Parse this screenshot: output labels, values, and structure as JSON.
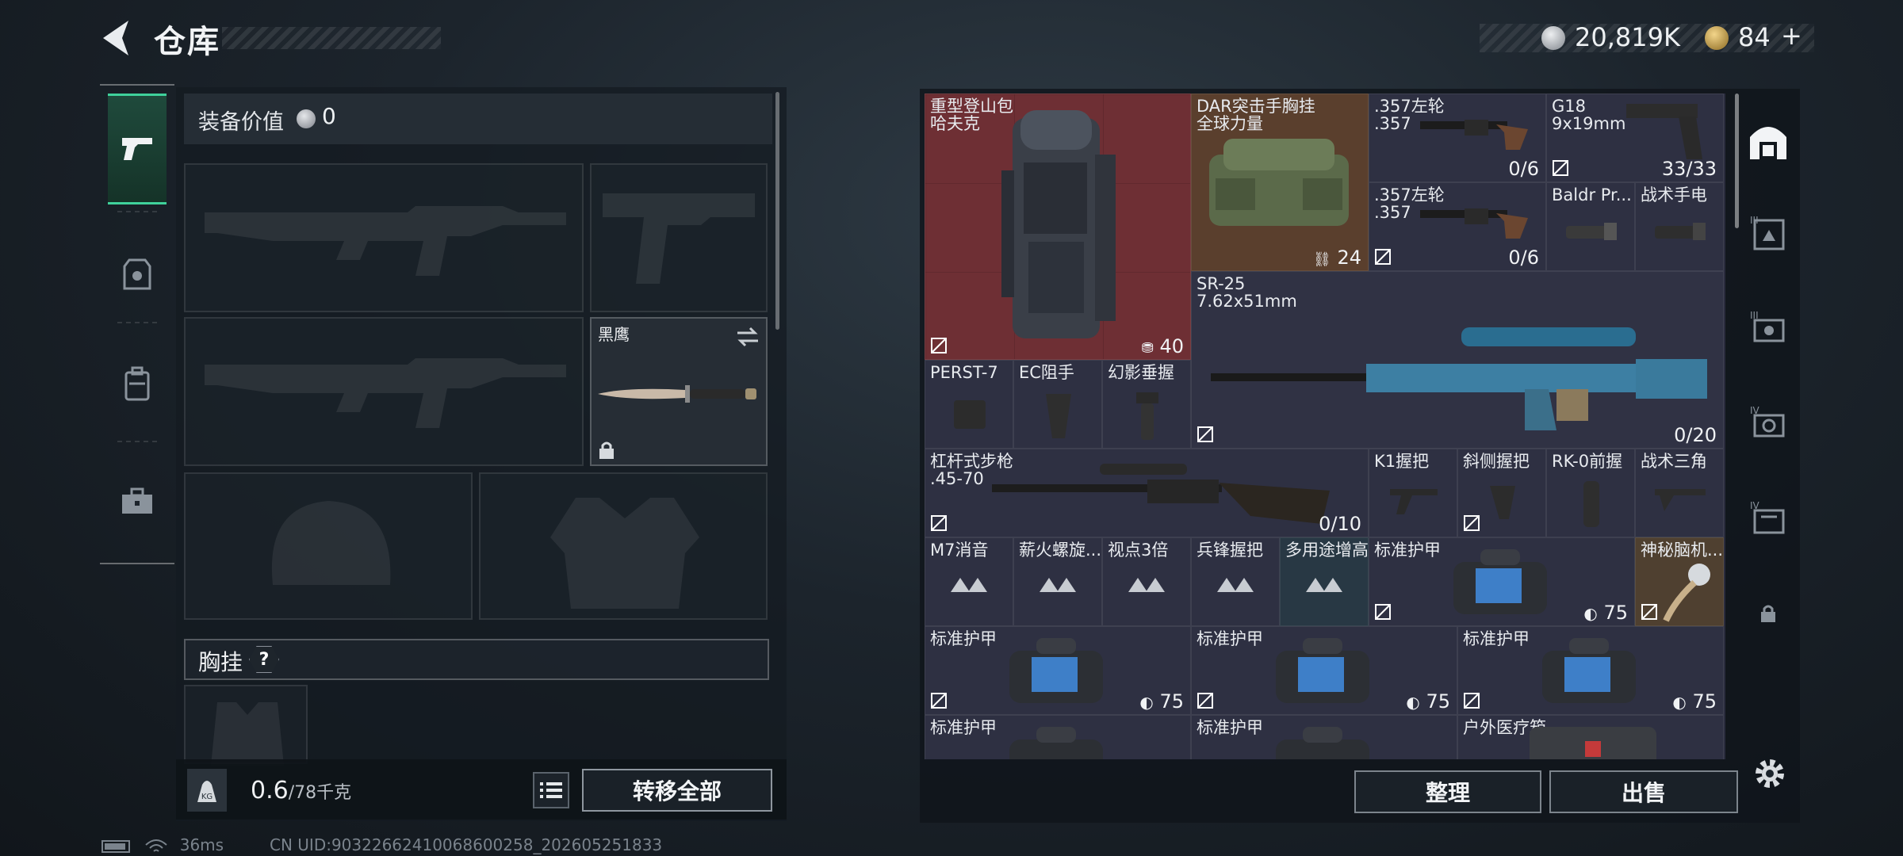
{
  "header": {
    "title": "仓库",
    "silver_amount": "20,819K",
    "gold_amount": "84",
    "gold_plus": "+"
  },
  "colors": {
    "accent_green": "#3fd19b",
    "backpack_bg": "#6e2f34",
    "rig_bg": "#5a3f2d",
    "knife_slot": "#2a3038",
    "grid_bg": "#2e3042"
  },
  "categories": [
    {
      "icon": "pistol-icon",
      "active": true
    },
    {
      "icon": "armor-icon",
      "active": false
    },
    {
      "icon": "backpack-icon",
      "active": false
    },
    {
      "icon": "toolbox-icon",
      "active": false
    }
  ],
  "equipment": {
    "value_label": "装备价值",
    "value": "0",
    "knife_name": "黑鹰",
    "chest_label": "胸挂",
    "chest_help": "?",
    "weight": "0.6",
    "weight_max": "/78千克",
    "transfer_all": "转移全部"
  },
  "status": {
    "ping": "36ms",
    "uid": "CN UID:90322662410068600258_202605251833"
  },
  "stash": {
    "items": [
      {
        "id": "backpack",
        "name1": "重型登山包",
        "name2": "哈夫克",
        "count": "40"
      },
      {
        "id": "rig",
        "name1": "DAR突击手胸挂",
        "name2": "全球力量",
        "count": "24"
      },
      {
        "id": "revolver1",
        "name1": ".357左轮",
        "name2": ".357",
        "count": "0/6"
      },
      {
        "id": "g18",
        "name1": "G18",
        "name2": "9x19mm",
        "count": "33/33"
      },
      {
        "id": "revolver2",
        "name1": ".357左轮",
        "name2": ".357",
        "count": "0/6"
      },
      {
        "id": "baldr",
        "name1": "Baldr Pr..."
      },
      {
        "id": "flashlight",
        "name1": "战术手电"
      },
      {
        "id": "sr25",
        "name1": "SR-25",
        "name2": "7.62x51mm",
        "count": "0/20"
      },
      {
        "id": "perst",
        "name1": "PERST-7"
      },
      {
        "id": "ec",
        "name1": "EC阻手"
      },
      {
        "id": "phantom",
        "name1": "幻影垂握"
      },
      {
        "id": "lever",
        "name1": "杠杆式步枪",
        "name2": ".45-70",
        "count": "0/10"
      },
      {
        "id": "k1",
        "name1": "K1握把"
      },
      {
        "id": "angled",
        "name1": "斜侧握把"
      },
      {
        "id": "rk0",
        "name1": "RK-0前握"
      },
      {
        "id": "tri",
        "name1": "战术三角"
      },
      {
        "id": "m7",
        "name1": "M7消音"
      },
      {
        "id": "xinhuo",
        "name1": "薪火螺旋..."
      },
      {
        "id": "sight",
        "name1": "视点3倍"
      },
      {
        "id": "vanguard",
        "name1": "兵锋握把"
      },
      {
        "id": "multi",
        "name1": "多用途增高"
      },
      {
        "id": "armor1",
        "name1": "标准护甲",
        "count": "75"
      },
      {
        "id": "mystery",
        "name1": "神秘脑机..."
      },
      {
        "id": "armor2",
        "name1": "标准护甲",
        "count": "75"
      },
      {
        "id": "armor3",
        "name1": "标准护甲",
        "count": "75"
      },
      {
        "id": "armor4",
        "name1": "标准护甲",
        "count": "75"
      },
      {
        "id": "armor5",
        "name1": "标准护甲"
      },
      {
        "id": "armor6",
        "name1": "标准护甲"
      },
      {
        "id": "medkit",
        "name1": "户外医疗箱"
      }
    ]
  },
  "side_tabs": [
    "home-tab",
    "tab-iii-a",
    "tab-iii-b",
    "tab-iv-a",
    "tab-iv-b",
    "lock-tab"
  ],
  "actions": {
    "sort": "整理",
    "sell": "出售"
  }
}
